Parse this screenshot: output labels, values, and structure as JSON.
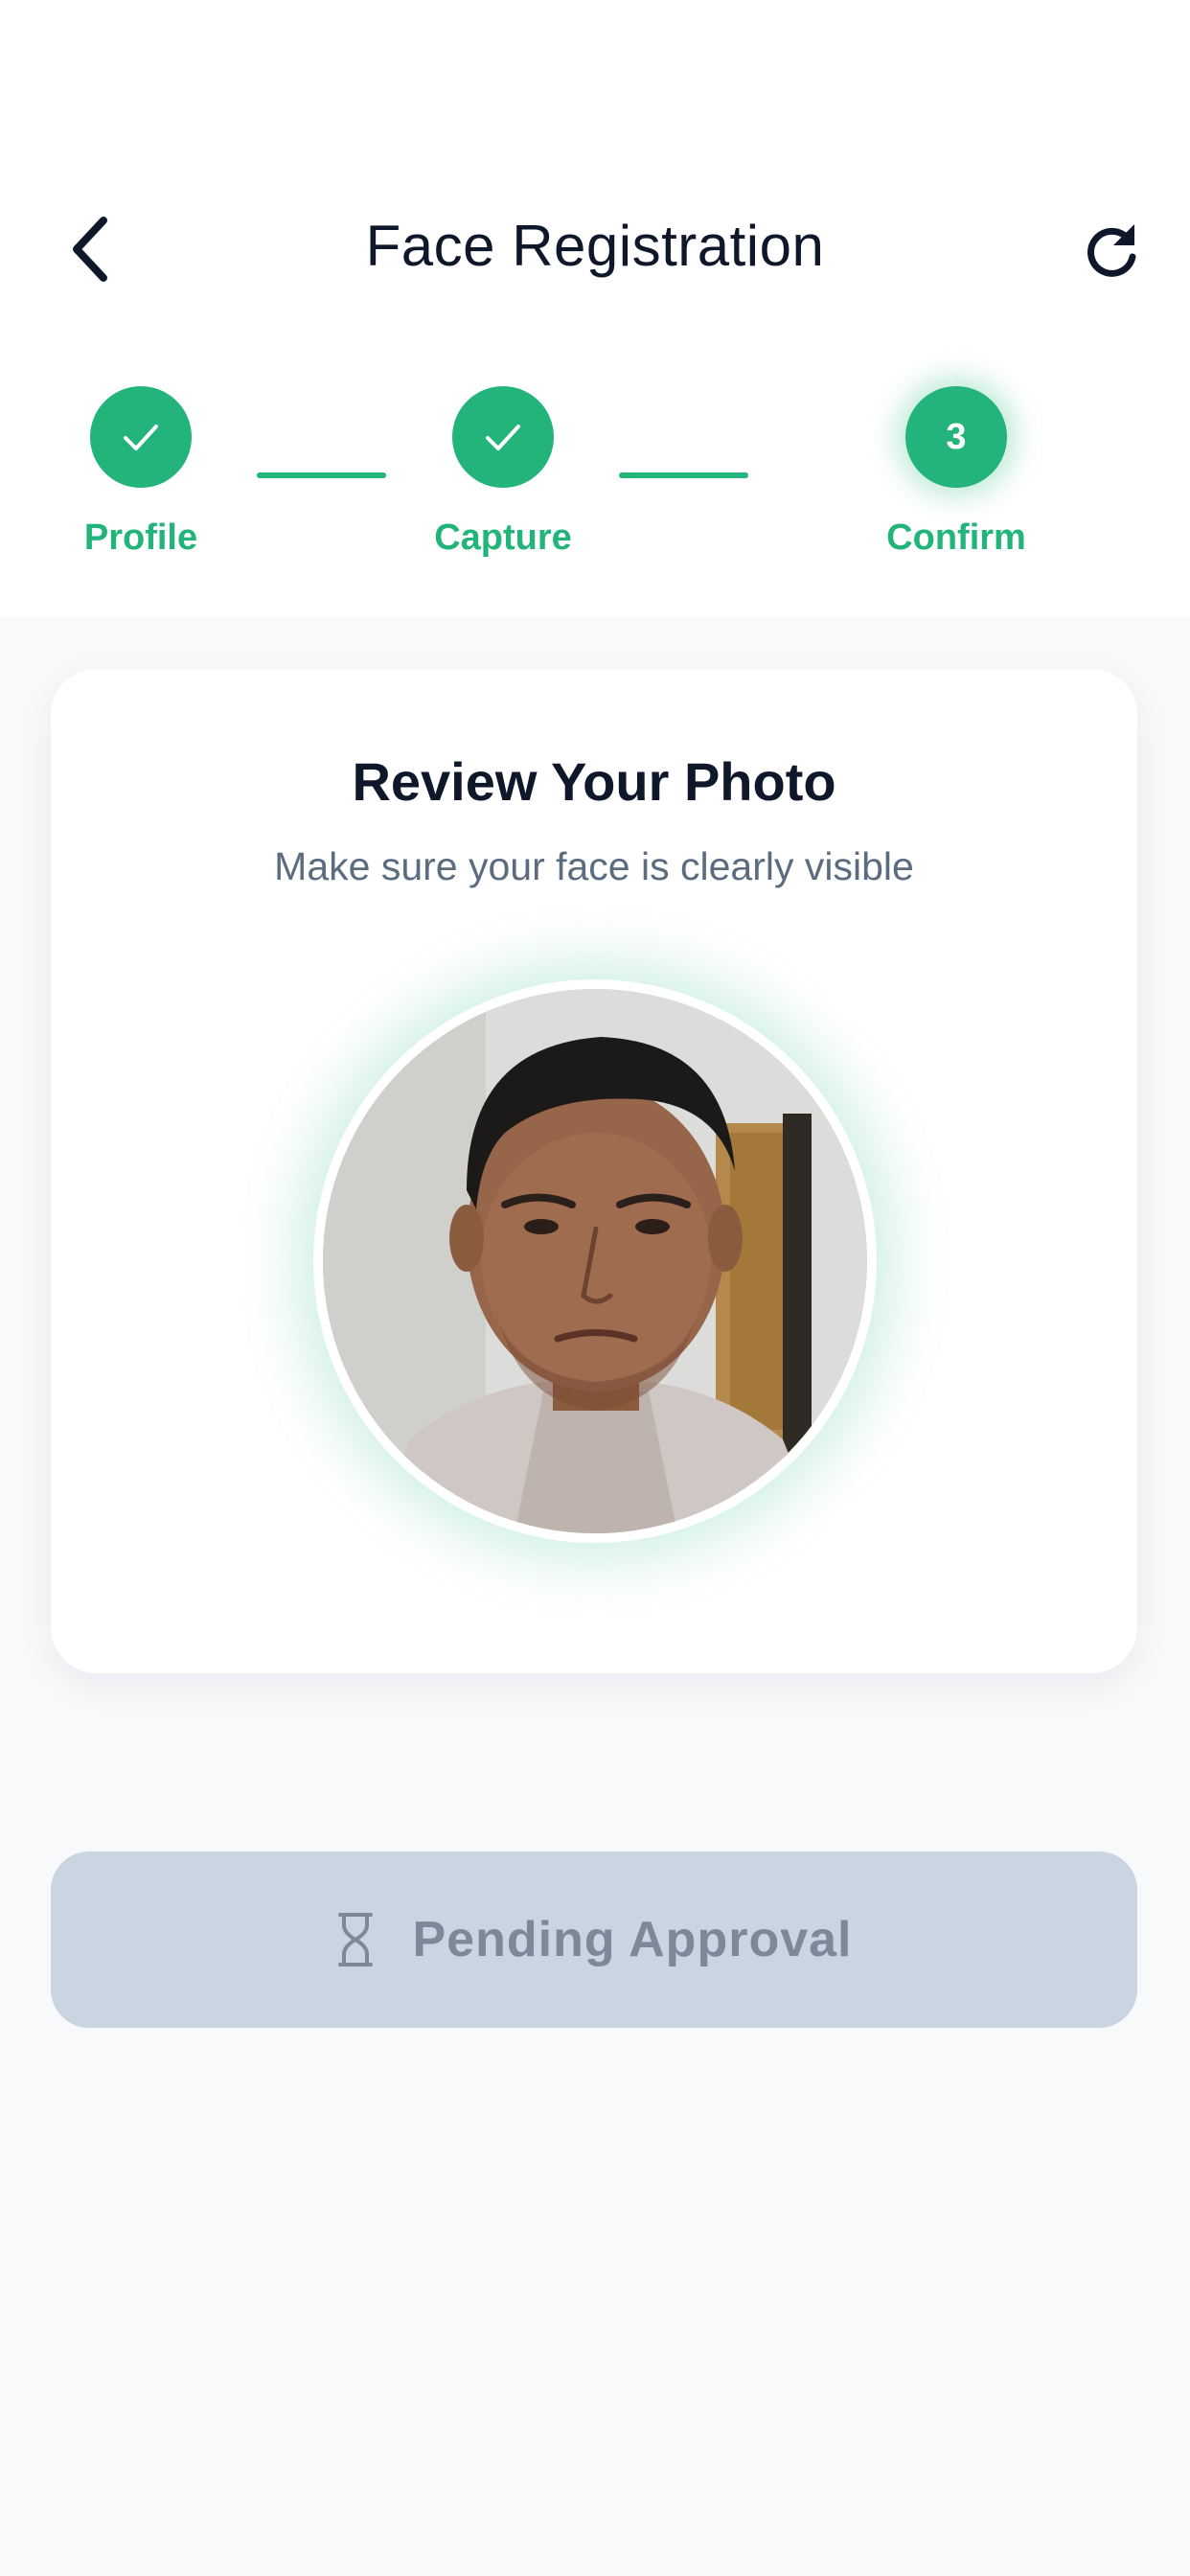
{
  "header": {
    "title": "Face Registration",
    "back_icon": "chevron-left-icon",
    "refresh_icon": "refresh-icon"
  },
  "stepper": {
    "steps": [
      {
        "label": "Profile",
        "status": "completed",
        "icon": "check-icon"
      },
      {
        "label": "Capture",
        "status": "completed",
        "icon": "check-icon"
      },
      {
        "label": "Confirm",
        "status": "active",
        "number": "3"
      }
    ]
  },
  "review_card": {
    "title": "Review Your Photo",
    "subtitle": "Make sure your face is clearly visible"
  },
  "status_button": {
    "label": "Pending Approval",
    "icon": "hourglass-icon"
  },
  "colors": {
    "accent": "#22b47a",
    "title_text": "#0f172a",
    "muted_text": "#5b6b80",
    "disabled_button": "#cbd5e1",
    "disabled_text": "#7d8898"
  }
}
